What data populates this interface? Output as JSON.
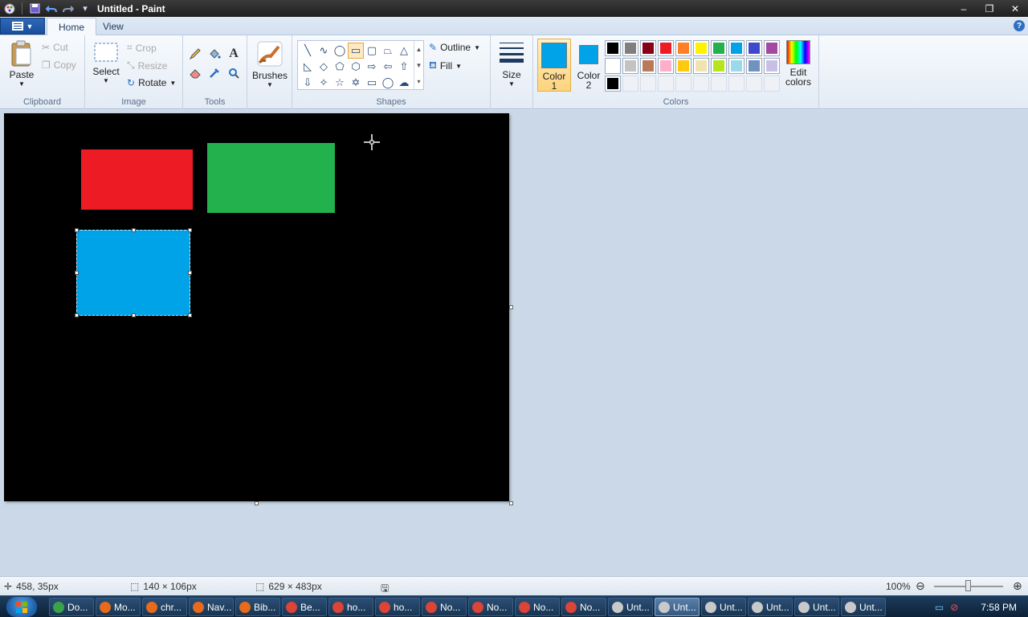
{
  "window": {
    "title": "Untitled - Paint",
    "controls": {
      "minimize": "–",
      "maximize": "❐",
      "close": "✕"
    }
  },
  "ribbon_tabs": [
    {
      "label": "Home",
      "active": true
    },
    {
      "label": "View",
      "active": false
    }
  ],
  "help_label": "?",
  "clipboard": {
    "group_label": "Clipboard",
    "paste_label": "Paste",
    "cut_label": "Cut",
    "copy_label": "Copy"
  },
  "image_group": {
    "group_label": "Image",
    "select_label": "Select",
    "crop_label": "Crop",
    "resize_label": "Resize",
    "rotate_label": "Rotate"
  },
  "tools_group": {
    "group_label": "Tools",
    "text_tool_glyph": "A"
  },
  "brushes": {
    "label": "Brushes"
  },
  "shapes_group": {
    "group_label": "Shapes",
    "outline_label": "Outline",
    "fill_label": "Fill"
  },
  "size": {
    "label": "Size"
  },
  "color1": {
    "label_line1": "Color",
    "label_line2": "1",
    "color": "#00a2e8"
  },
  "color2": {
    "label_line1": "Color",
    "label_line2": "2",
    "color": "#00a2e8"
  },
  "colors_group": {
    "group_label": "Colors",
    "edit_line1": "Edit",
    "edit_line2": "colors",
    "palette": [
      "#000000",
      "#7f7f7f",
      "#880015",
      "#ed1c24",
      "#ff7f27",
      "#fff200",
      "#22b14c",
      "#00a2e8",
      "#3f48cc",
      "#a349a4",
      "#ffffff",
      "#c3c3c3",
      "#b97a57",
      "#ffaec9",
      "#ffc90e",
      "#efe4b0",
      "#b5e61d",
      "#99d9ea",
      "#7092be",
      "#c8bfe7",
      "#000000",
      "",
      "",
      "",
      "",
      "",
      "",
      "",
      "",
      ""
    ]
  },
  "canvas": {
    "background": "#000000",
    "shapes": [
      {
        "name": "red-rectangle",
        "color": "#ed1c24"
      },
      {
        "name": "green-rectangle",
        "color": "#22b14c"
      },
      {
        "name": "blue-rectangle",
        "color": "#00a2e8"
      }
    ]
  },
  "status": {
    "cursor_pos": "458, 35px",
    "selection_size": "140 × 106px",
    "canvas_size": "629 × 483px",
    "zoom": "100%",
    "zoom_value": 100
  },
  "taskbar": {
    "tasks": [
      {
        "label": "Do...",
        "icon_color": "#3aa34a"
      },
      {
        "label": "Mo...",
        "icon_color": "#e86a1c"
      },
      {
        "label": "chr...",
        "icon_color": "#e86a1c"
      },
      {
        "label": "Nav...",
        "icon_color": "#e86a1c"
      },
      {
        "label": "Bib...",
        "icon_color": "#e86a1c"
      },
      {
        "label": "Be...",
        "icon_color": "#db4437"
      },
      {
        "label": "ho...",
        "icon_color": "#db4437"
      },
      {
        "label": "ho...",
        "icon_color": "#db4437"
      },
      {
        "label": "No...",
        "icon_color": "#db4437"
      },
      {
        "label": "No...",
        "icon_color": "#db4437"
      },
      {
        "label": "No...",
        "icon_color": "#db4437"
      },
      {
        "label": "No...",
        "icon_color": "#db4437"
      },
      {
        "label": "Unt...",
        "icon_color": "#c9c9c9"
      },
      {
        "label": "Unt...",
        "icon_color": "#c9c9c9",
        "active": true
      },
      {
        "label": "Unt...",
        "icon_color": "#c9c9c9"
      },
      {
        "label": "Unt...",
        "icon_color": "#c9c9c9"
      },
      {
        "label": "Unt...",
        "icon_color": "#c9c9c9"
      },
      {
        "label": "Unt...",
        "icon_color": "#c9c9c9"
      }
    ],
    "clock": "7:58 PM"
  }
}
